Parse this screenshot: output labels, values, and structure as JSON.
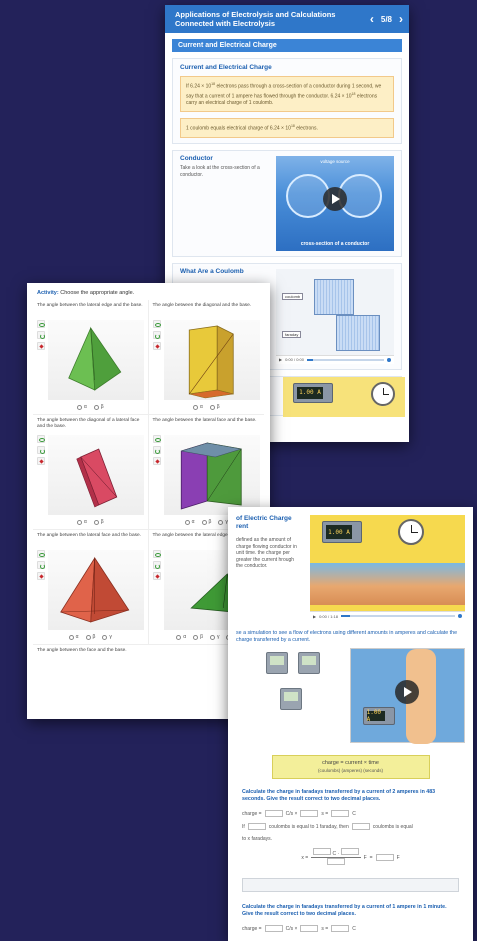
{
  "cardA": {
    "title": "Applications of Electrolysis and Calculations Connected with Electrolysis",
    "page_indicator": "5/8",
    "prev_label": "‹",
    "next_label": "›",
    "section_title": "Current and Electrical Charge",
    "panel1": {
      "heading": "Current and Electrical Charge",
      "note1_a": "If 6.24 × 10",
      "note1_sup1": "18",
      "note1_b": " electrons pass through a cross-section of a conductor during 1 second, we say that a current of 1 ampere has flowed through the conductor. 6.24 × 10",
      "note1_sup2": "18",
      "note1_c": " electrons carry an electrical charge of 1 coulomb.",
      "note2_a": "1 coulomb equals electrical charge of 6.24 × 10",
      "note2_sup": "18",
      "note2_b": " electrons."
    },
    "panel2": {
      "heading": "Conductor",
      "text": "Take a look at the cross-section of a conductor.",
      "media_top": "voltage source",
      "media_caption": "cross-section of a conductor"
    },
    "panel3": {
      "heading": "What Are a Coulomb",
      "tag_top": "coulomb",
      "tag_bottom": "faraday",
      "time": "0:00 / 0:00"
    },
    "panel4": {
      "display": "1.00 A"
    }
  },
  "cardB": {
    "activity_label": "Activity:",
    "activity_text": " Choose the appropriate angle.",
    "cells": [
      {
        "question": "The angle between the lateral edge and the base.",
        "options": [
          "α",
          "β"
        ]
      },
      {
        "question": "The angle between the diagonal and the base.",
        "options": [
          "α",
          "β"
        ]
      },
      {
        "question": "The angle between the diagonal of a lateral face and the base.",
        "options": [
          "α",
          "β"
        ]
      },
      {
        "question": "The angle between the lateral face and the base.",
        "options": [
          "α",
          "β",
          "γ"
        ]
      },
      {
        "question": "The angle between the lateral face and the base.",
        "options": [
          "α",
          "β",
          "γ"
        ]
      },
      {
        "question": "The angle between the lateral edge and the base.",
        "options": [
          "α",
          "β",
          "γ",
          "δ"
        ]
      }
    ],
    "last_question": "The angle between the face and the base."
  },
  "cardC": {
    "top_title": "of Electric Charge rent",
    "top_text": "defined as the amount of charge flowing conductor in unit time. the charge per greater the current hrough the conductor.",
    "video_display": "1.00 A",
    "video_time": "0:00 / 1:18",
    "mid_text": "se a simulation to see a flow of electrons using different amounts in amperes and calculate the charge transferred by a current.",
    "sim_display": "1.00 A",
    "formula_line1": "charge  =  current  ×  time",
    "formula_line2": "(coulombs)  (amperes)  (seconds)",
    "q1": "Calculate the charge in faradays transferred by a current of 2 amperes in 483 seconds. Give the result correct to two decimal places.",
    "line_charge": "charge =",
    "unit_cs": "C/s ×",
    "unit_s": "s =",
    "unit_c": "C",
    "if_label": "If",
    "if_text1": "coulombs is equal to 1 faraday, then",
    "if_text2": "coulombs is equal",
    "if_text3": "to x faradays.",
    "x_label": "x =",
    "frac_top": "C ·",
    "frac_f": "F",
    "frac_eq": "=",
    "q2": "Calculate the charge in faradays transferred by a current of 1 ampere in 1 minute. Give the result correct to two decimal places."
  }
}
